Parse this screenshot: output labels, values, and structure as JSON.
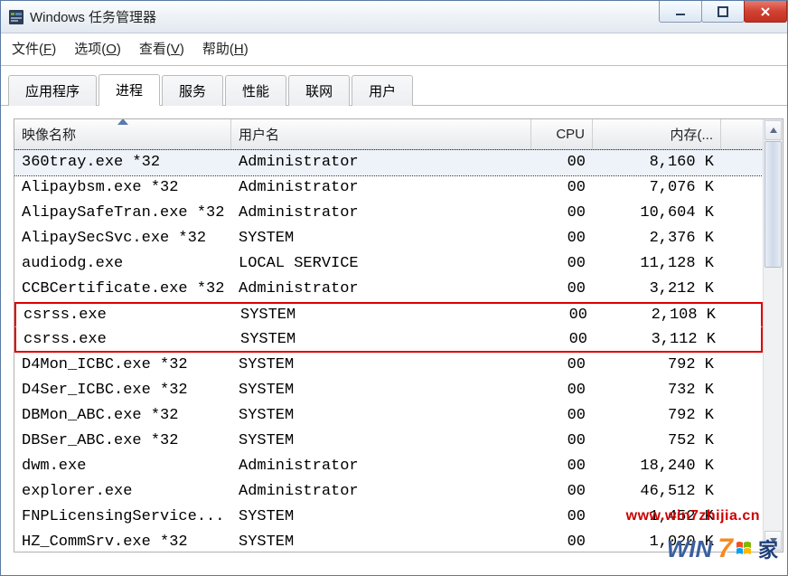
{
  "window": {
    "title": "Windows 任务管理器"
  },
  "menu": {
    "file": "文件",
    "file_u": "F",
    "options": "选项",
    "options_u": "O",
    "view": "查看",
    "view_u": "V",
    "help": "帮助",
    "help_u": "H"
  },
  "tabs": {
    "applications": "应用程序",
    "processes": "进程",
    "services": "服务",
    "performance": "性能",
    "networking": "联网",
    "users": "用户",
    "active_index": 1
  },
  "columns": {
    "image_name": "映像名称",
    "user_name": "用户名",
    "cpu": "CPU",
    "memory": "内存(..."
  },
  "processes": [
    {
      "name": "360tray.exe *32",
      "user": "Administrator",
      "cpu": "00",
      "mem": "8,160 K",
      "selected": true
    },
    {
      "name": "Alipaybsm.exe *32",
      "user": "Administrator",
      "cpu": "00",
      "mem": "7,076 K"
    },
    {
      "name": "AlipaySafeTran.exe *32",
      "user": "Administrator",
      "cpu": "00",
      "mem": "10,604 K"
    },
    {
      "name": "AlipaySecSvc.exe *32",
      "user": "SYSTEM",
      "cpu": "00",
      "mem": "2,376 K"
    },
    {
      "name": "audiodg.exe",
      "user": "LOCAL SERVICE",
      "cpu": "00",
      "mem": "11,128 K"
    },
    {
      "name": "CCBCertificate.exe *32",
      "user": "Administrator",
      "cpu": "00",
      "mem": "3,212 K"
    },
    {
      "name": "csrss.exe",
      "user": "SYSTEM",
      "cpu": "00",
      "mem": "2,108 K",
      "hl": "top"
    },
    {
      "name": "csrss.exe",
      "user": "SYSTEM",
      "cpu": "00",
      "mem": "3,112 K",
      "hl": "bottom"
    },
    {
      "name": "D4Mon_ICBC.exe *32",
      "user": "SYSTEM",
      "cpu": "00",
      "mem": "792 K"
    },
    {
      "name": "D4Ser_ICBC.exe *32",
      "user": "SYSTEM",
      "cpu": "00",
      "mem": "732 K"
    },
    {
      "name": "DBMon_ABC.exe *32",
      "user": "SYSTEM",
      "cpu": "00",
      "mem": "792 K"
    },
    {
      "name": "DBSer_ABC.exe *32",
      "user": "SYSTEM",
      "cpu": "00",
      "mem": "752 K"
    },
    {
      "name": "dwm.exe",
      "user": "Administrator",
      "cpu": "00",
      "mem": "18,240 K"
    },
    {
      "name": "explorer.exe",
      "user": "Administrator",
      "cpu": "00",
      "mem": "46,512 K"
    },
    {
      "name": "FNPLicensingService...",
      "user": "SYSTEM",
      "cpu": "00",
      "mem": "1,452 K"
    },
    {
      "name": "HZ_CommSrv.exe *32",
      "user": "SYSTEM",
      "cpu": "00",
      "mem": "1,020 K"
    }
  ],
  "watermark": {
    "url": "www.win7zhijia.cn",
    "brand_left": "WIN",
    "brand_right": "7",
    "brand_home": "家"
  }
}
